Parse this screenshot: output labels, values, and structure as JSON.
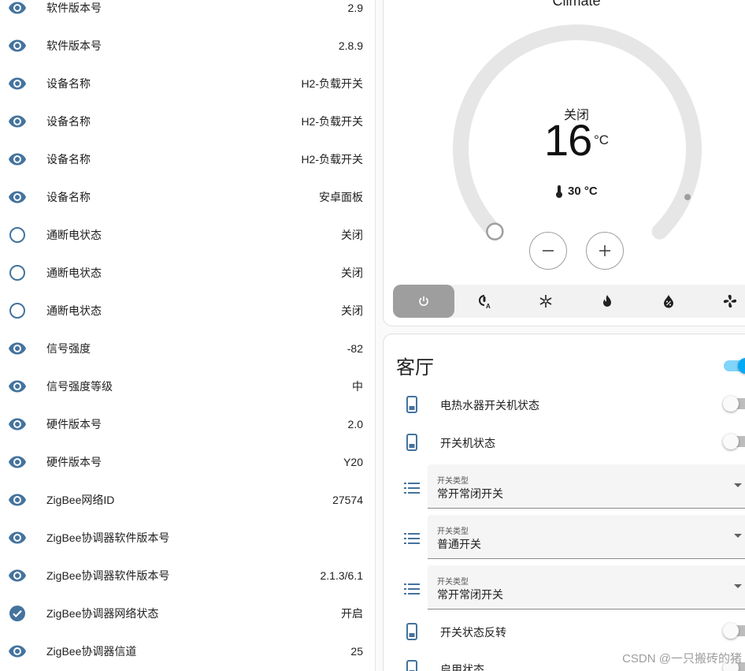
{
  "entity_list": [
    {
      "icon": "eye-icon",
      "name": "软件版本号",
      "value": "2.9"
    },
    {
      "icon": "eye-icon",
      "name": "软件版本号",
      "value": "2.8.9"
    },
    {
      "icon": "eye-icon",
      "name": "设备名称",
      "value": "H2-负载开关"
    },
    {
      "icon": "eye-icon",
      "name": "设备名称",
      "value": "H2-负载开关"
    },
    {
      "icon": "eye-icon",
      "name": "设备名称",
      "value": "H2-负载开关"
    },
    {
      "icon": "eye-icon",
      "name": "设备名称",
      "value": "安卓面板"
    },
    {
      "icon": "circle-outline-icon",
      "name": "通断电状态",
      "value": "关闭"
    },
    {
      "icon": "circle-outline-icon",
      "name": "通断电状态",
      "value": "关闭"
    },
    {
      "icon": "circle-outline-icon",
      "name": "通断电状态",
      "value": "关闭"
    },
    {
      "icon": "eye-icon",
      "name": "信号强度",
      "value": "-82"
    },
    {
      "icon": "eye-icon",
      "name": "信号强度等级",
      "value": "中"
    },
    {
      "icon": "eye-icon",
      "name": "硬件版本号",
      "value": "2.0"
    },
    {
      "icon": "eye-icon",
      "name": "硬件版本号",
      "value": "Y20"
    },
    {
      "icon": "eye-icon",
      "name": "ZigBee网络ID",
      "value": "27574"
    },
    {
      "icon": "eye-icon",
      "name": "ZigBee协调器软件版本号",
      "value": ""
    },
    {
      "icon": "eye-icon",
      "name": "ZigBee协调器软件版本号",
      "value": "2.1.3/6.1"
    },
    {
      "icon": "check-circle-icon",
      "name": "ZigBee协调器网络状态",
      "value": "开启"
    },
    {
      "icon": "eye-icon",
      "name": "ZigBee协调器信道",
      "value": "25"
    }
  ],
  "climate": {
    "name": "Climate",
    "state": "关闭",
    "target_temp": "16",
    "unit": "°C",
    "current_temp": "30 °C",
    "min_temp": 16,
    "max_temp": 30,
    "modes": [
      {
        "icon": "power-icon",
        "label": "off",
        "active": true
      },
      {
        "icon": "thermostat-auto-icon",
        "label": "auto",
        "active": false
      },
      {
        "icon": "snowflake-icon",
        "label": "cool",
        "active": false
      },
      {
        "icon": "fire-icon",
        "label": "heat",
        "active": false
      },
      {
        "icon": "water-percent-icon",
        "label": "dry",
        "active": false
      },
      {
        "icon": "fan-icon",
        "label": "fan",
        "active": false
      }
    ]
  },
  "room": {
    "title": "客厅",
    "master_toggle_on": true,
    "rows": [
      {
        "kind": "switch",
        "icon": "tablet-icon",
        "label": "电热水器开关机状态",
        "on": false
      },
      {
        "kind": "switch",
        "icon": "tablet-icon",
        "label": "开关机状态",
        "on": false
      },
      {
        "kind": "select",
        "icon": "list-icon",
        "field_label": "开关类型",
        "value": "常开常闭开关"
      },
      {
        "kind": "select",
        "icon": "list-icon",
        "field_label": "开关类型",
        "value": "普通开关"
      },
      {
        "kind": "select",
        "icon": "list-icon",
        "field_label": "开关类型",
        "value": "常开常闭开关"
      },
      {
        "kind": "switch",
        "icon": "tablet-icon",
        "label": "开关状态反转",
        "on": false
      },
      {
        "kind": "switch",
        "icon": "tablet-icon",
        "label": "启用状态",
        "on": false
      }
    ]
  },
  "watermark": "CSDN @一只搬砖的猪",
  "colors": {
    "icon_blue": "#44739e",
    "accent": "#03a9f4",
    "dial_track": "#e6e6e6"
  }
}
